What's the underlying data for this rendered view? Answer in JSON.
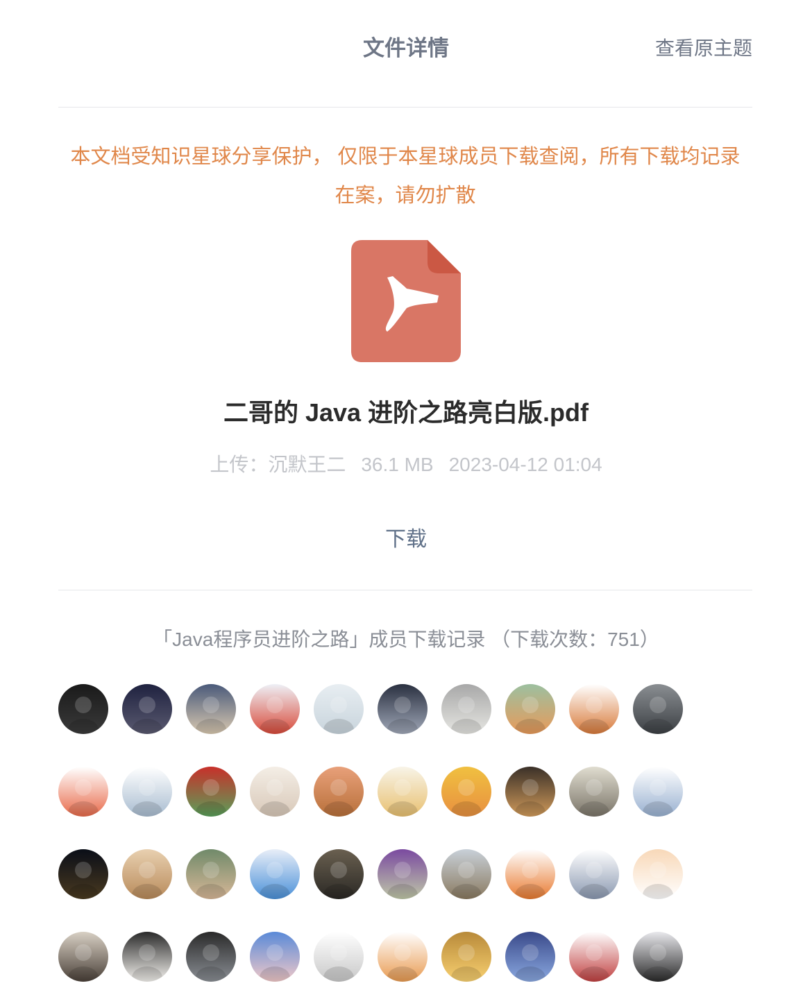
{
  "header": {
    "title": "文件详情",
    "view_original": "查看原主题"
  },
  "notice": {
    "line1": "本文档受知识星球分享保护， 仅限于本星球成员下载查阅，所有下载均记录",
    "line2": "在案，请勿扩散"
  },
  "file": {
    "icon": "pdf-file-icon",
    "name": "二哥的 Java 进阶之路亮白版.pdf",
    "uploader": "上传：沉默王二",
    "size": "36.1 MB",
    "uploaded_at": "2023-04-12 01:04",
    "download_label": "下载"
  },
  "records": {
    "label": "「Java程序员进阶之路」成员下载记录 （下载次数：751）"
  },
  "colors": {
    "accent_orange": "#e0874a",
    "pdf_red": "#d97665",
    "pdf_fold": "#cb5844",
    "link_gray": "#6e7686"
  },
  "avatars": [
    {
      "top": "#1a1a1a",
      "bottom": "#3a3a3a"
    },
    {
      "top": "#1f2240",
      "bottom": "#5a5a70"
    },
    {
      "top": "#4a5a7a",
      "bottom": "#d8c8b0"
    },
    {
      "top": "#eef0f6",
      "bottom": "#d84a3a"
    },
    {
      "top": "#e8eef2",
      "bottom": "#c8d4dc"
    },
    {
      "top": "#2a3040",
      "bottom": "#a0a8b8"
    },
    {
      "top": "#a8a8a8",
      "bottom": "#e6e6e2"
    },
    {
      "top": "#9cc0a0",
      "bottom": "#e89a5a"
    },
    {
      "top": "#ffffff",
      "bottom": "#d87a3a"
    },
    {
      "top": "#8a8e92",
      "bottom": "#3c4044"
    },
    {
      "top": "#ffffff",
      "bottom": "#e86a4a"
    },
    {
      "top": "#ffffff",
      "bottom": "#a8bcd0"
    },
    {
      "top": "#c8302a",
      "bottom": "#5aa05a"
    },
    {
      "top": "#f4eee6",
      "bottom": "#d8c8b8"
    },
    {
      "top": "#e8a07a",
      "bottom": "#b8703a"
    },
    {
      "top": "#f8f4e8",
      "bottom": "#e8c070"
    },
    {
      "top": "#f0c040",
      "bottom": "#e89040"
    },
    {
      "top": "#3a3028",
      "bottom": "#d09a5a"
    },
    {
      "top": "#e0ddd0",
      "bottom": "#7a7468"
    },
    {
      "top": "#ffffff",
      "bottom": "#98b0d0"
    },
    {
      "top": "#0a0e18",
      "bottom": "#4a3a20"
    },
    {
      "top": "#e8d0b0",
      "bottom": "#b88a5a"
    },
    {
      "top": "#708a6a",
      "bottom": "#d8b898"
    },
    {
      "top": "#e8eef8",
      "bottom": "#4a90d8"
    },
    {
      "top": "#6a6050",
      "bottom": "#2a2824"
    },
    {
      "top": "#7a4aa0",
      "bottom": "#c0c8a8"
    },
    {
      "top": "#c8d0d8",
      "bottom": "#8a7a60"
    },
    {
      "top": "#ffffff",
      "bottom": "#e87a30"
    },
    {
      "top": "#ffffff",
      "bottom": "#8a98b0"
    },
    {
      "top": "#f8d8b8",
      "bottom": "#ffffff"
    },
    {
      "top": "#d8d0c4",
      "bottom": "#4a4038"
    },
    {
      "top": "#2a2a2a",
      "bottom": "#f4f2ee"
    },
    {
      "top": "#2a2a2a",
      "bottom": "#8a8e94"
    },
    {
      "top": "#5a8ad8",
      "bottom": "#f0c8c8"
    },
    {
      "top": "#ffffff",
      "bottom": "#c8c8c8"
    },
    {
      "top": "#ffffff",
      "bottom": "#e89a50"
    },
    {
      "top": "#b88a3a",
      "bottom": "#f8d070"
    },
    {
      "top": "#3a4a8a",
      "bottom": "#8aa8e0"
    },
    {
      "top": "#ffffff",
      "bottom": "#c04040"
    },
    {
      "top": "#e8e8ec",
      "bottom": "#2a2a2a"
    }
  ]
}
